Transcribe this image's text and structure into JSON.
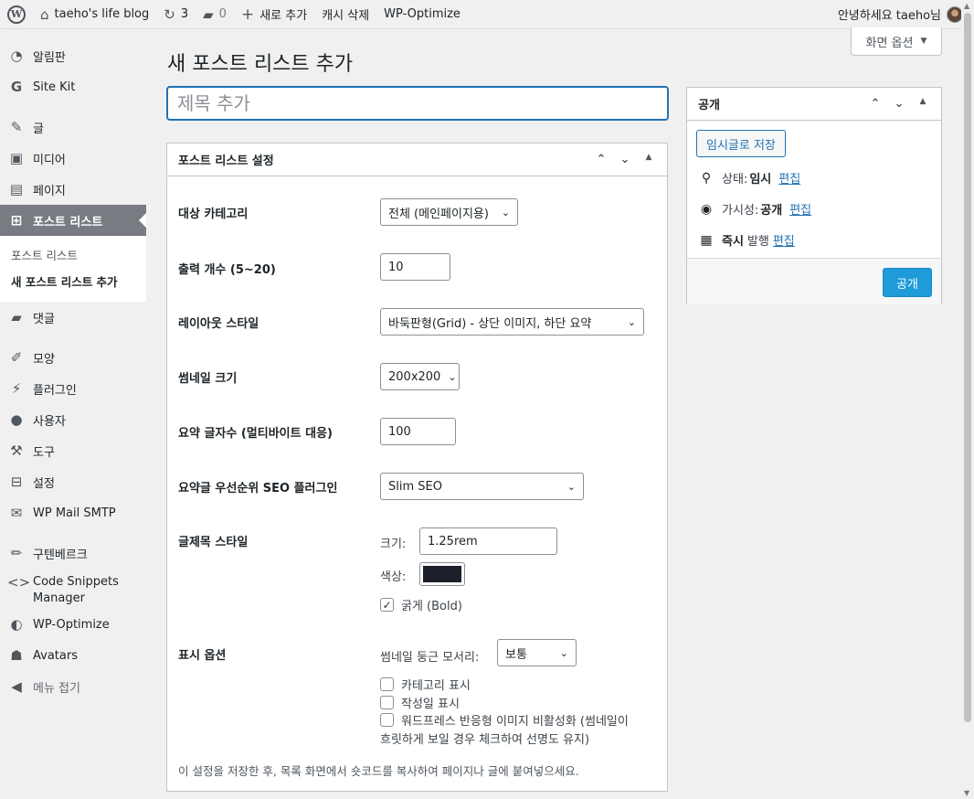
{
  "adminbar": {
    "site_name": "taeho's life blog",
    "updates_count": "3",
    "comments_count": "0",
    "new_label": "새로 추가",
    "cache_label": "캐시 삭제",
    "optimize_label": "WP-Optimize",
    "greeting": "안녕하세요 taeho님"
  },
  "sidebar": {
    "items": [
      {
        "label": "알림판",
        "icon": "dashboard-icon"
      },
      {
        "label": "Site Kit",
        "icon": "sitekit-icon"
      },
      {
        "label": "글",
        "icon": "pin-icon"
      },
      {
        "label": "미디어",
        "icon": "media-icon"
      },
      {
        "label": "페이지",
        "icon": "page-icon"
      },
      {
        "label": "포스트 리스트",
        "icon": "grid-icon"
      },
      {
        "label": "댓글",
        "icon": "comment-icon"
      },
      {
        "label": "모양",
        "icon": "brush-icon"
      },
      {
        "label": "플러그인",
        "icon": "plugin-icon"
      },
      {
        "label": "사용자",
        "icon": "user-icon"
      },
      {
        "label": "도구",
        "icon": "wrench-icon"
      },
      {
        "label": "설정",
        "icon": "settings-icon"
      },
      {
        "label": "WP Mail SMTP",
        "icon": "mail-icon"
      },
      {
        "label": "구텐베르크",
        "icon": "pencil-icon"
      },
      {
        "label": "Code Snippets Manager",
        "icon": "code-icon"
      },
      {
        "label": "WP-Optimize",
        "icon": "optimize-icon"
      },
      {
        "label": "Avatars",
        "icon": "avatars-icon"
      },
      {
        "label": "메뉴 접기",
        "icon": "collapse-icon"
      }
    ],
    "submenu": [
      "포스트 리스트",
      "새 포스트 리스트 추가"
    ]
  },
  "main": {
    "screen_options": "화면 옵션",
    "page_title": "새 포스트 리스트 추가",
    "title_placeholder": "제목 추가"
  },
  "settings": {
    "box_title": "포스트 리스트 설정",
    "category_label": "대상 카테고리",
    "category_value": "전체 (메인페이지용)",
    "count_label": "출력 개수 (5~20)",
    "count_value": "10",
    "layout_label": "레이아웃 스타일",
    "layout_value": "바둑판형(Grid) - 상단 이미지, 하단 요약",
    "thumb_label": "썸네일 크기",
    "thumb_value": "200x200",
    "excerpt_label": "요약 글자수 (멀티바이트 대응)",
    "excerpt_value": "100",
    "seo_label": "요약글 우선순위 SEO 플러그인",
    "seo_value": "Slim SEO",
    "title_style_label": "글제목 스타일",
    "size_label": "크기:",
    "size_value": "1.25rem",
    "color_label": "색상:",
    "color_value": "#1d1f2a",
    "bold_label": "굵게 (Bold)",
    "bold_checked": true,
    "display_label": "표시 옵션",
    "radius_label": "썸네일 둥근 모서리:",
    "radius_value": "보통",
    "show_category_label": "카테고리 표시",
    "show_date_label": "작성일 표시",
    "disable_responsive_line1": "워드프레스 반응형 이미지 비활성화 (썸네일이",
    "disable_responsive_line2": "흐릿하게 보일 경우 체크하여 선명도 유지)",
    "note": "이 설정을 저장한 후, 목록 화면에서 숏코드를 복사하여 페이지나 글에 붙여넣으세요."
  },
  "publish": {
    "box_title": "공개",
    "save_draft": "임시글로 저장",
    "status_label": "상태:",
    "status_value": "임시",
    "visibility_label": "가시성:",
    "visibility_value": "공개",
    "schedule_value": "즉시",
    "schedule_label": "발행",
    "edit_label": "편집",
    "publish_button": "공개"
  }
}
